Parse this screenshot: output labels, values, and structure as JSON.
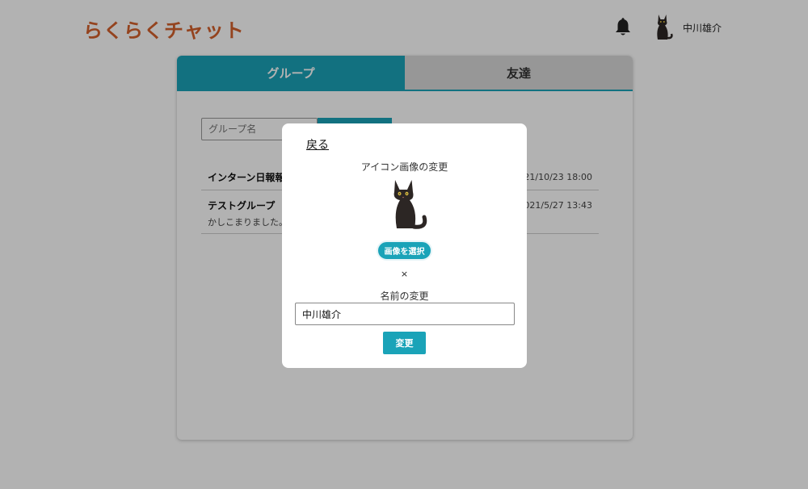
{
  "app": {
    "title": "らくらくチャット"
  },
  "header": {
    "user_name": "中川雄介",
    "bell_icon": "bell-icon",
    "avatar_icon": "black-cat-icon"
  },
  "tabs": [
    {
      "label": "グループ",
      "active": true
    },
    {
      "label": "友達",
      "active": false
    }
  ],
  "search": {
    "placeholder": "グループ名",
    "button_label": ""
  },
  "groups": [
    {
      "name": "インターン日報報告",
      "last_message": "",
      "time": "2021/10/23 18:00"
    },
    {
      "name": "テストグループ",
      "last_message": "かしこまりました。",
      "time": "2021/5/27 13:43"
    }
  ],
  "modal": {
    "back_label": "戻る",
    "icon_section_label": "アイコン画像の変更",
    "select_image_label": "画像を選択",
    "remove_label": "×",
    "name_section_label": "名前の変更",
    "name_value": "中川雄介",
    "submit_label": "変更"
  },
  "colors": {
    "accent": "#1aa3b8",
    "brand": "#d4602c",
    "overlay": "rgba(0,0,0,0.3)"
  }
}
